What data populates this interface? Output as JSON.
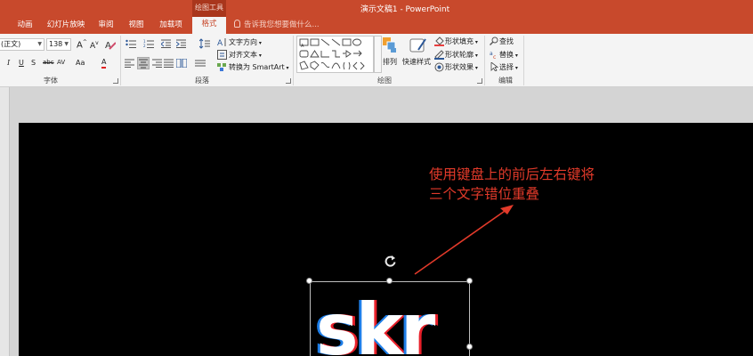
{
  "window": {
    "title": "演示文稿1 - PowerPoint"
  },
  "context_group": {
    "label": "绘图工具"
  },
  "tabs": [
    {
      "label": "动画"
    },
    {
      "label": "幻灯片放映"
    },
    {
      "label": "审阅"
    },
    {
      "label": "视图"
    },
    {
      "label": "加载项"
    },
    {
      "label": "格式"
    }
  ],
  "tell_me": {
    "placeholder": "告诉我您想要做什么..."
  },
  "ribbon": {
    "font": {
      "label": "字体",
      "font_name": "(正文)",
      "font_size": "138",
      "grow": "A",
      "shrink": "A",
      "italic": "I",
      "underline": "U",
      "shadow": "S",
      "strike": "abc",
      "spacing": "AV",
      "case": "Aa",
      "color": "A"
    },
    "paragraph": {
      "label": "段落",
      "text_direction": "文字方向",
      "align_text": "对齐文本",
      "convert_smartart": "转换为 SmartArt"
    },
    "drawing": {
      "label": "绘图",
      "arrange": "排列",
      "quick_styles": "快速样式",
      "shape_fill": "形状填充",
      "shape_outline": "形状轮廓",
      "shape_effects": "形状效果"
    },
    "editing": {
      "label": "编辑",
      "find": "查找",
      "replace": "替换",
      "select": "选择"
    }
  },
  "slide": {
    "annotation_line1": "使用键盘上的前后左右键将",
    "annotation_line2": "三个文字错位重叠",
    "text": "skr"
  },
  "colors": {
    "ribbon_accent": "#c8492c",
    "annotation_red": "#e23a2a",
    "glitch_red": "#e8202a",
    "glitch_blue": "#1e7ee8",
    "text_white": "#ffffff"
  }
}
